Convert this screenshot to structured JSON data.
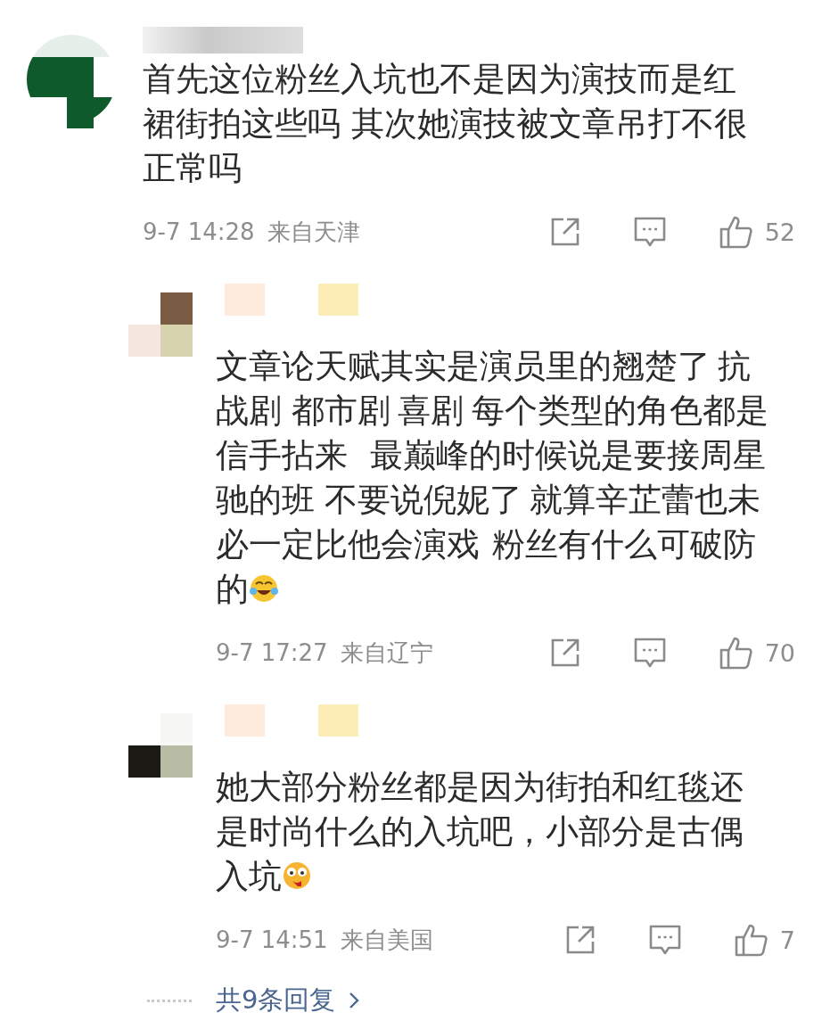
{
  "comment": {
    "text": "首先这位粉丝入坑也不是因为演技而是红裙街拍这些吗 其次她演技被文章吊打不很正常吗",
    "time": "9-7 14:28",
    "location": "来自天津",
    "likes": "52"
  },
  "replies": [
    {
      "text": "文章论天赋其实是演员里的翘楚了   抗战剧    都市剧   喜剧   每个类型的角色都是信手拈来         最巅峰的时候说是要接周星驰的班    不要说倪妮了   就算辛芷蕾也未必一定比他会演戏     粉丝有什么可破防的",
      "time": "9-7 17:27",
      "location": "来自辽宁",
      "likes": "70"
    },
    {
      "text": "她大部分粉丝都是因为街拍和红毯还是时尚什么的入坑吧，小部分是古偶入坑",
      "time": "9-7 14:51",
      "location": "来自美国",
      "likes": "7"
    }
  ],
  "more_replies": "共9条回复"
}
